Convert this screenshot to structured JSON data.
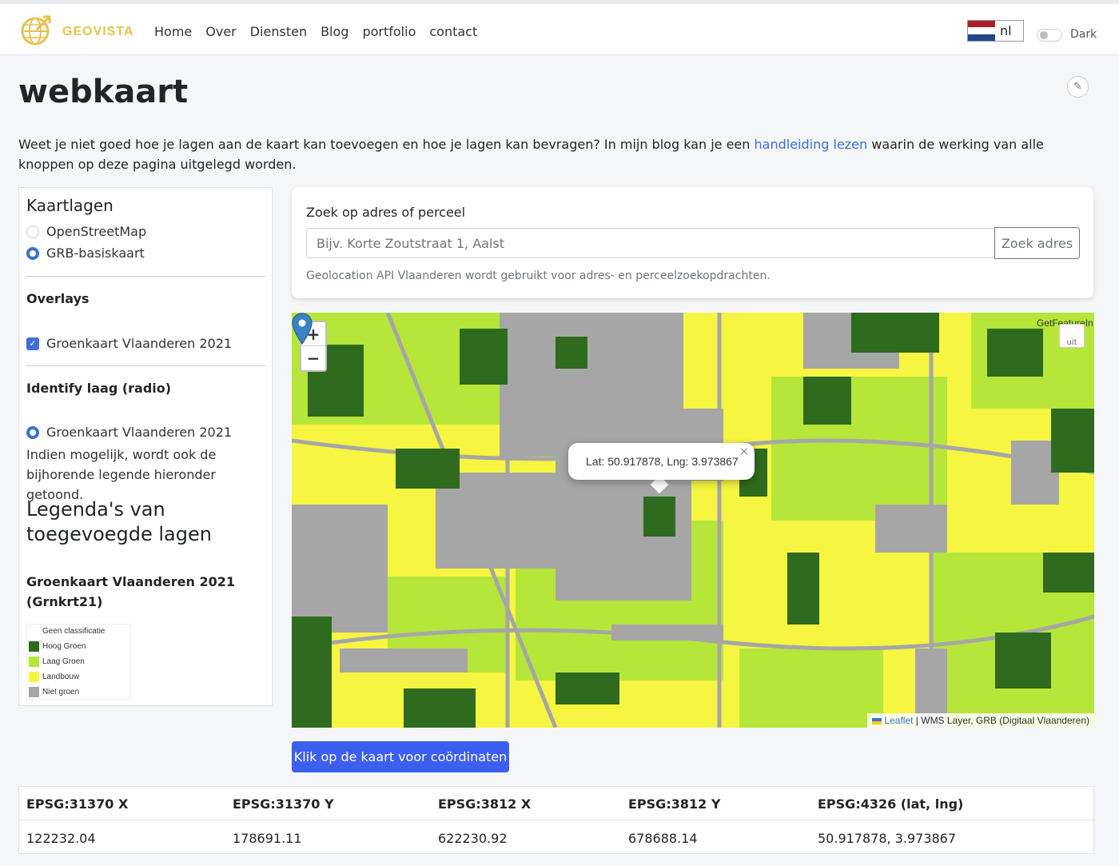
{
  "brand": {
    "name": "GEOVISTA"
  },
  "nav": {
    "items": [
      "Home",
      "Over",
      "Diensten",
      "Blog",
      "portfolio",
      "contact"
    ]
  },
  "lang": {
    "code": "nl"
  },
  "theme": {
    "toggle_label": "Dark"
  },
  "page": {
    "title": "webkaart"
  },
  "intro": {
    "before": "Weet je niet goed hoe je lagen aan de kaart kan toevoegen en hoe je lagen kan bevragen? In mijn blog kan je een ",
    "link": "handleiding lezen",
    "after": " waarin de werking van alle knoppen op deze pagina uitgelegd worden."
  },
  "sidebar": {
    "heading": "Kaartlagen",
    "base_layers": [
      {
        "label": "OpenStreetMap",
        "checked": false
      },
      {
        "label": "GRB-basiskaart",
        "checked": true
      }
    ],
    "overlays_heading": "Overlays",
    "overlay": "Groenkaart Vlaanderen 2021",
    "identify_heading": "Identify laag (radio)",
    "identify_layer": "Groenkaart Vlaanderen 2021",
    "identify_note": "Indien mogelijk, wordt ook de bijhorende legende hieronder getoond.",
    "legend_heading": "Legenda's van toegevoegde lagen",
    "legend_layer_title": "Groenkaart Vlaanderen 2021 (Grnkrt21)",
    "legend_items": [
      {
        "label": "Geen classificatie",
        "color": "#ffffff"
      },
      {
        "label": "Hoog Groen",
        "color": "#2e6b1e"
      },
      {
        "label": "Laag Groen",
        "color": "#b6e63a"
      },
      {
        "label": "Landbouw",
        "color": "#f5f542"
      },
      {
        "label": "Niet groen",
        "color": "#a6a6a6"
      }
    ]
  },
  "search": {
    "label": "Zoek op adres of perceel",
    "placeholder": "Bijv. Korte Zoutstraat 1, Aalst",
    "button": "Zoek adres",
    "hint": "Geolocation API Vlaanderen wordt gebruikt voor adres- en perceelzoekopdrachten."
  },
  "map": {
    "zoom_in": "+",
    "zoom_out": "−",
    "getfeature_label": "GetFeatureIn",
    "getfeature_btn": "uit",
    "popup_text": "Lat: 50.917878, Lng: 3.973867",
    "popup_close": "×",
    "attribution_link": "Leaflet",
    "attribution_text": " | WMS Layer, GRB (Digitaal Vlaanderen)",
    "colors": {
      "landbouw": "#f5f542",
      "laag_groen": "#b6e63a",
      "hoog_groen": "#2e6b1e",
      "niet_groen": "#a6a6a6"
    }
  },
  "coord_button": "Klik op de kaart voor coördinaten",
  "coord_table": {
    "headers": [
      "EPSG:31370 X",
      "EPSG:31370 Y",
      "EPSG:3812 X",
      "EPSG:3812 Y",
      "EPSG:4326 (lat, lng)"
    ],
    "values": [
      "122232.04",
      "178691.11",
      "622230.92",
      "678688.14",
      "50.917878, 3.973867"
    ]
  }
}
